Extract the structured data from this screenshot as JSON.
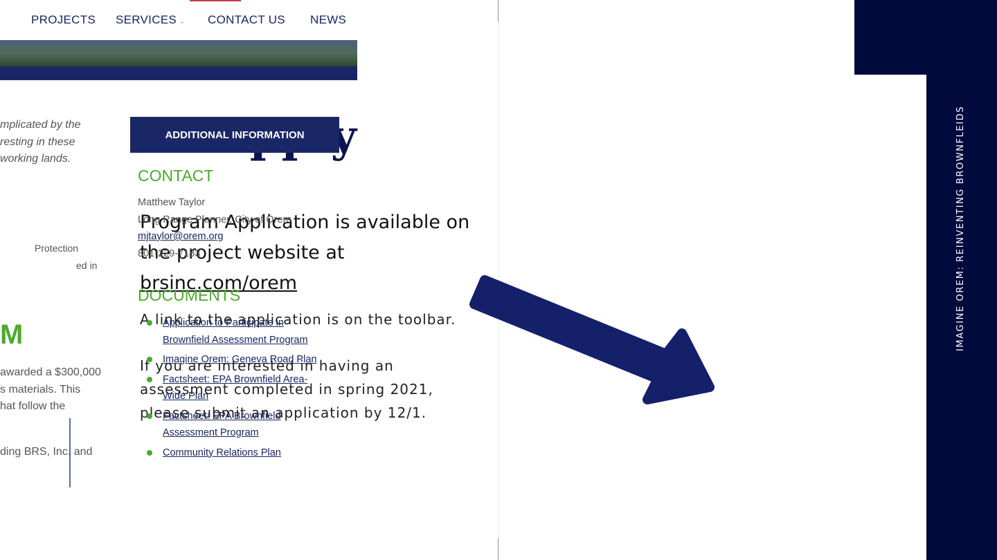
{
  "slide": {
    "title": "To Apply",
    "lead_text": "Program Application is available on the project website at",
    "lead_link": "brsinc.com/orem",
    "note1": "A link to the application is on the toolbar.",
    "note2": "If you are interested in having an assessment completed in spring 2021, please submit an application by 12/1.",
    "side_title": "IMAGINE OREM: REINVENTING BROWNFLEIDS",
    "colors": {
      "navy": "#000a3d",
      "accent_blue": "#15206a",
      "green": "#4aaa2e",
      "active_red": "#c8384a"
    }
  },
  "website": {
    "nav": {
      "projects": "PROJECTS",
      "services": "SERVICES",
      "contact": "CONTACT US",
      "news": "NEWS",
      "active": "CONTACT US"
    },
    "body_fragments": [
      "mplicated by the",
      "resting in these",
      "working lands.",
      "Protection",
      "ed in",
      "M",
      "awarded a $300,000",
      "s materials. This",
      "hat follow the",
      "ding BRS, Inc. and"
    ],
    "additional_info": "ADDITIONAL INFORMATION",
    "contact_heading": "CONTACT",
    "contact": {
      "name": "Matthew Taylor",
      "role": "Long Range Planner, City of Orem",
      "email": "mjtaylor@orem.org",
      "phone": "801-229-7183"
    },
    "documents_heading": "DOCUMENTS",
    "documents": [
      "Application to Participate in Brownfield Assessment Program",
      "Imagine Orem: Geneva Road Plan",
      "Factsheet: EPA Brownfield Area-Wide Plan",
      "Factsheet: EPA Brownfield Assessment Program",
      "Community Relations Plan"
    ]
  }
}
